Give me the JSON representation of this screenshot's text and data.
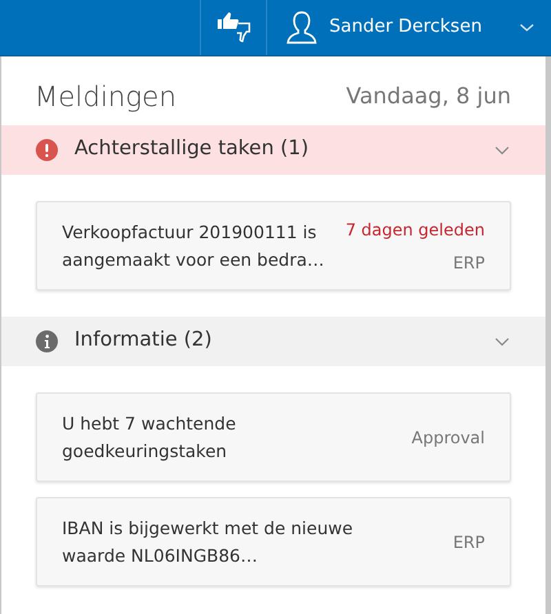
{
  "top_bar": {
    "user_name": "Sander Dercksen"
  },
  "panel": {
    "title": "Meldingen",
    "date": "Vandaag, 8 jun"
  },
  "sections": [
    {
      "kind": "overdue",
      "title": "Achterstallige taken (1)",
      "expanded": true,
      "items": [
        {
          "text": "Verkoopfactuur 201900111 is aangemaakt voor een bedra…",
          "time": "7 dagen geleden",
          "source": "ERP"
        }
      ]
    },
    {
      "kind": "info",
      "title": "Informatie (2)",
      "expanded": true,
      "items": [
        {
          "text": "U hebt 7 wachtende goedkeuringstaken",
          "source": "Approval"
        },
        {
          "text": "IBAN is bijgewerkt met de nieuwe waarde NL06INGB86…",
          "source": "ERP"
        }
      ]
    }
  ]
}
